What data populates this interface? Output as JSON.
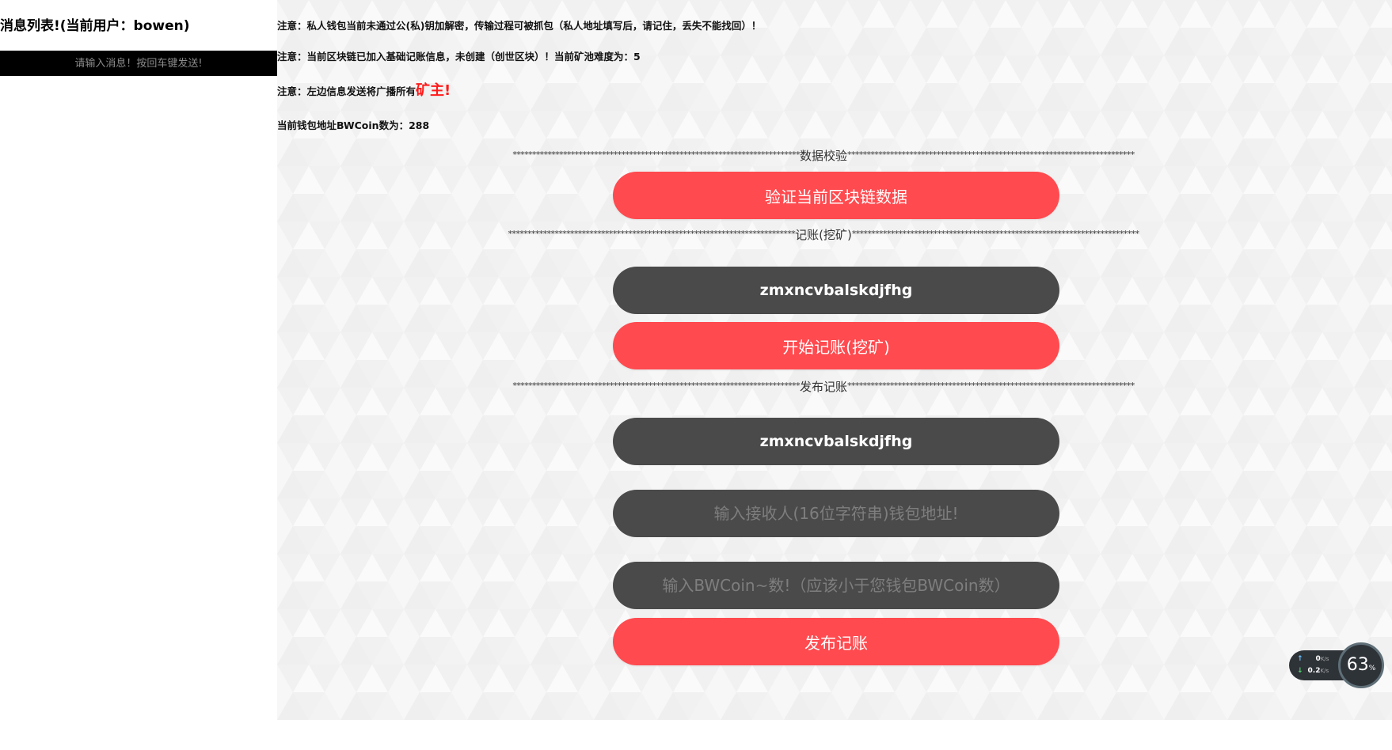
{
  "sidebar": {
    "title": "消息列表!(当前用户：bowen)",
    "message_input_placeholder": "请输入消息！按回车键发送!"
  },
  "notices": {
    "line1": "注意：私人钱包当前未通过公(私)钥加解密，传输过程可被抓包（私人地址填写后，请记住，丢失不能找回）！",
    "line2": "注意：当前区块链已加入基础记账信息，未创建（创世区块）！当前矿池难度为：5",
    "line3_prefix": "注意：左边信息发送将广播所有",
    "line3_highlight": "矿主!",
    "line4": "当前钱包地址BWCoin数为：288"
  },
  "sections": {
    "verify": {
      "stars_left": "**************************************************************************",
      "label": "数据校验",
      "stars_right": "**************************************************************************",
      "button": "验证当前区块链数据"
    },
    "mining": {
      "stars_left": "**************************************************************************",
      "label": "记账(挖矿)",
      "stars_right": "**************************************************************************",
      "address_value": "zmxncvbalskdjfhg",
      "button": "开始记账(挖矿)"
    },
    "publish": {
      "stars_left": "**************************************************************************",
      "label": "发布记账",
      "stars_right": "**************************************************************************",
      "address_value": "zmxncvbalskdjfhg",
      "receiver_placeholder": "输入接收人(16位字符串)钱包地址!",
      "amount_placeholder": "输入BWCoin~数!（应该小于您钱包BWCoin数）",
      "button": "发布记账"
    }
  },
  "net_widget": {
    "upload": "0",
    "upload_unit": "K/s",
    "download": "0.2",
    "download_unit": "K/s",
    "percent": "63",
    "percent_unit": "%"
  },
  "colors": {
    "accent_red": "#ff4a4f",
    "dark_pill": "#4a4a4a",
    "highlight_red": "#ff1a1a"
  }
}
